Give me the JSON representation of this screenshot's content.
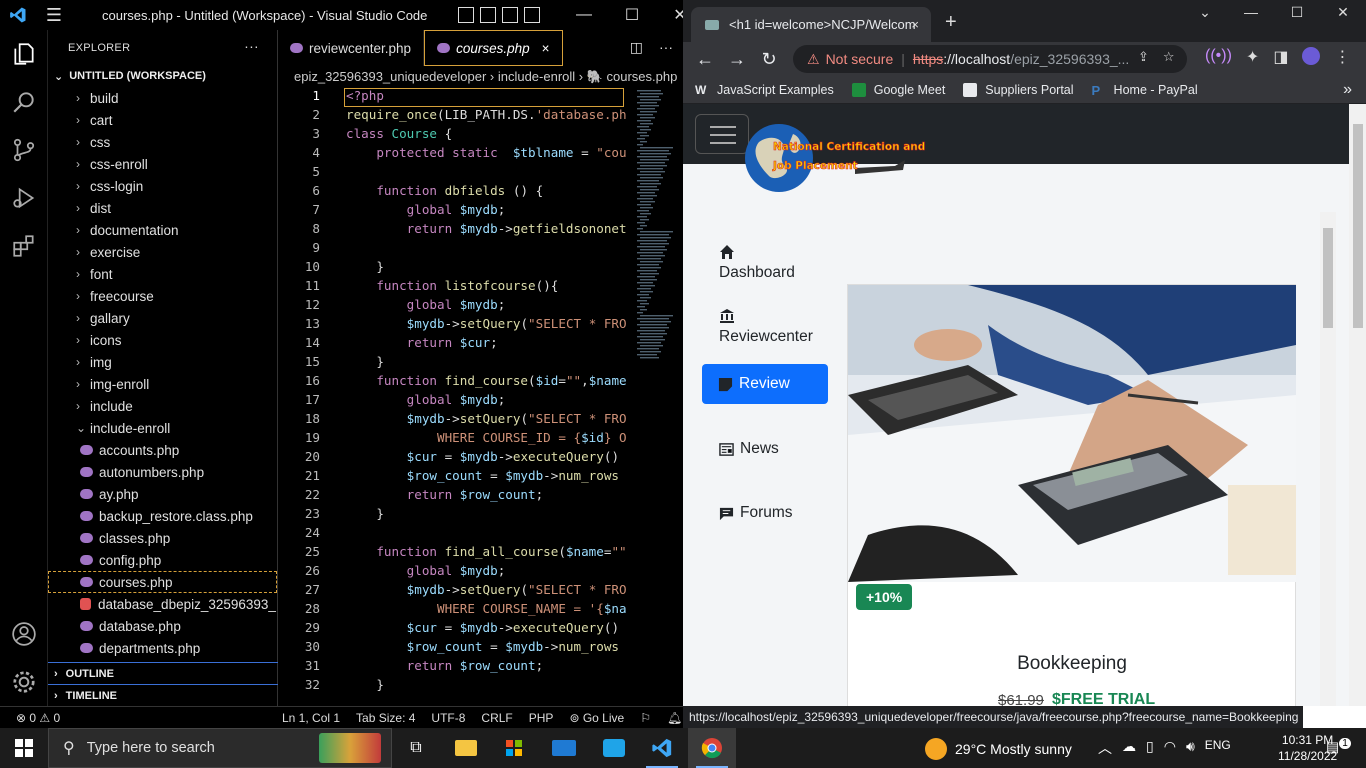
{
  "vscode": {
    "title": "courses.php - Untitled (Workspace) - Visual Studio Code",
    "explorer_label": "EXPLORER",
    "explorer_more": "···",
    "workspace": "UNTITLED (WORKSPACE)",
    "folders": [
      "build",
      "cart",
      "css",
      "css-enroll",
      "css-login",
      "dist",
      "documentation",
      "exercise",
      "font",
      "freecourse",
      "gallary",
      "icons",
      "img",
      "img-enroll",
      "include",
      "include-enroll"
    ],
    "files": [
      "accounts.php",
      "autonumbers.php",
      "ay.php",
      "backup_restore.class.php",
      "classes.php",
      "config.php",
      "courses.php",
      "database_dbepiz_32596393_...",
      "database.php",
      "departments.php"
    ],
    "outline": "OUTLINE",
    "timeline": "TIMELINE",
    "tabs": [
      "reviewcenter.php",
      "courses.php"
    ],
    "tab_close": "×",
    "breadcrumb": "epiz_32596393_uniquedeveloper › include-enroll › 🐘 courses.php",
    "status": {
      "errors": "⊗ 0 ⚠ 0",
      "position": "Ln 1, Col 1",
      "tab_size": "Tab Size: 4",
      "encoding": "UTF-8",
      "eol": "CRLF",
      "language": "PHP",
      "golive": "⊚ Go Live"
    },
    "code_lines": 32
  },
  "chrome": {
    "tab_title": "<h1 id=welcome>NCJP/Welcom",
    "tab_close": "×",
    "new_tab": "+",
    "not_secure": "Not secure",
    "url_scheme": "https",
    "url_host": "://localhost",
    "url_path": "/epiz_32596393_...",
    "bookmarks": [
      "JavaScript Examples",
      "Google Meet",
      "Suppliers Portal",
      "Home - PayPal"
    ],
    "bookmarks_more": "»",
    "status_url": "https://localhost/epiz_32596393_uniquedeveloper/freecourse/java/freecourse.php?freecourse_name=Bookkeeping"
  },
  "page": {
    "logo_line1": "National Certification and",
    "logo_line2": "Job Placement",
    "menu": [
      "Dashboard",
      "Reviewcenter",
      "Review",
      "News",
      "Forums"
    ],
    "card": {
      "badge": "+10%",
      "title": "Bookkeeping",
      "old_price": "$61.99",
      "new_price": "$FREE TRIAL"
    }
  },
  "taskbar": {
    "search_placeholder": "Type here to search",
    "weather": "29°C  Mostly sunny",
    "language": "ENG",
    "time": "10:31 PM",
    "date": "11/28/2022",
    "notifications": "1"
  }
}
